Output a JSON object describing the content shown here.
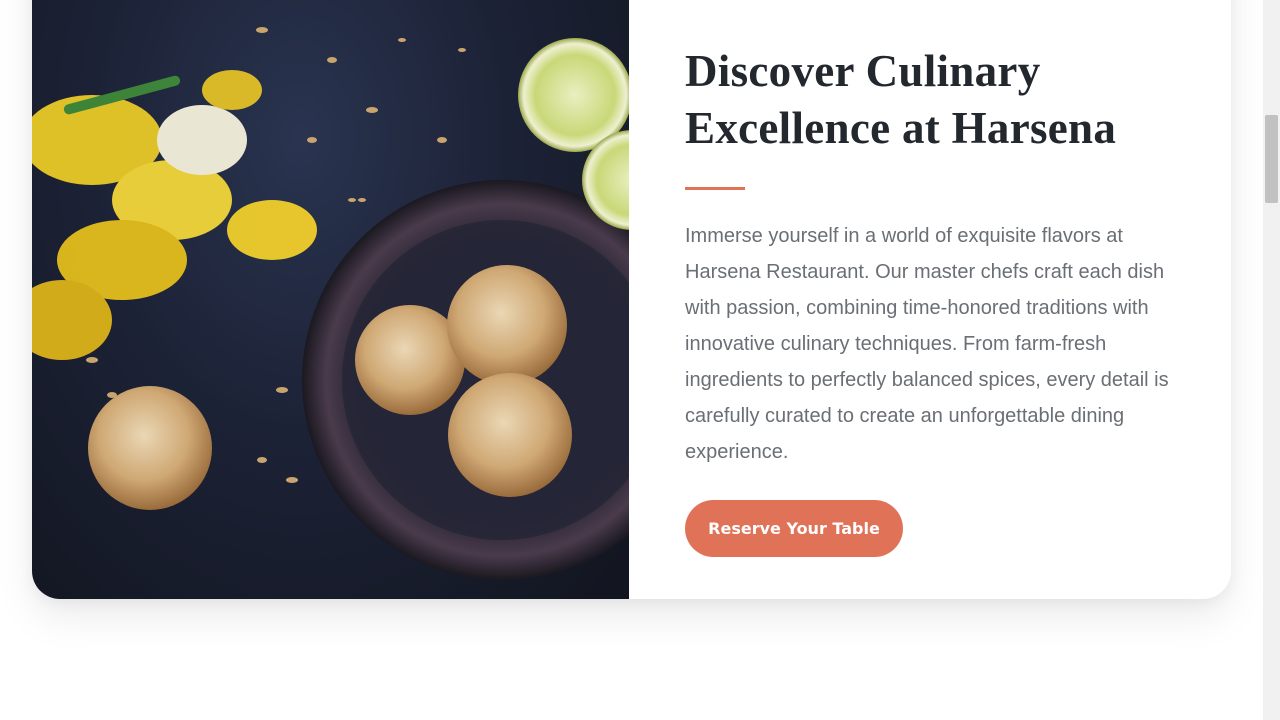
{
  "section": {
    "heading": "Discover Culinary Excellence at Harsena",
    "description": "Immerse yourself in a world of exquisite flavors at Harsena Restaurant. Our master chefs craft each dish with passion, combining time-honored traditions with innovative culinary techniques. From farm-fresh ingredients to perfectly balanced spices, every detail is carefully curated to create an unforgettable dining experience.",
    "cta_label": "Reserve Your Table"
  },
  "colors": {
    "accent": "#e07258",
    "heading": "#23272e",
    "body": "#6a6f75"
  },
  "icons": {
    "photo": "food-photo-cookies-daffodils-lemon"
  }
}
